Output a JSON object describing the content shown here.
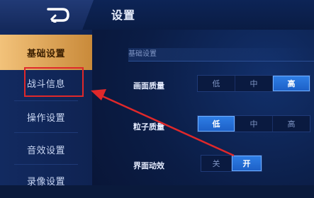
{
  "header": {
    "title": "设置"
  },
  "sidebar": {
    "items": [
      {
        "label": "基础设置"
      },
      {
        "label": "战斗信息"
      },
      {
        "label": "操作设置"
      },
      {
        "label": "音效设置"
      },
      {
        "label": "录像设置"
      }
    ],
    "active_index": 0
  },
  "main": {
    "section_title": "基础设置",
    "settings": [
      {
        "label": "画面质量",
        "options": [
          "低",
          "中",
          "高"
        ],
        "selected": "高"
      },
      {
        "label": "粒子质量",
        "options": [
          "低",
          "中",
          "高"
        ],
        "selected": "低"
      },
      {
        "label": "界面动效",
        "options": [
          "关",
          "开"
        ],
        "selected": "开"
      }
    ]
  },
  "colors": {
    "accent_active_tab": "#e9b066",
    "selected_option": "#2f7fe6",
    "annotation_red": "#e0282a",
    "background": "#0a1a3c"
  },
  "icons": [
    "back-arrow-icon"
  ]
}
